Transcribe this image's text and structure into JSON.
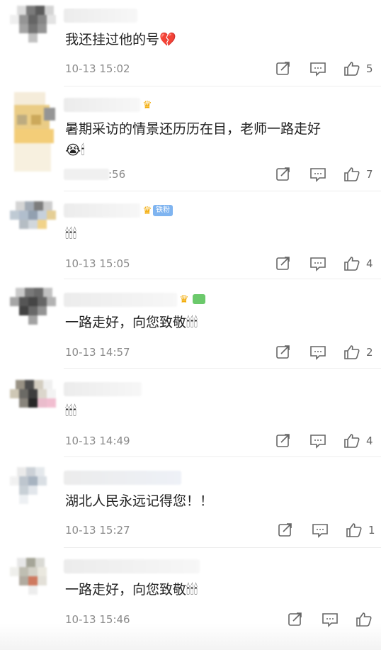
{
  "comments": [
    {
      "text": "我还挂过他的号",
      "emoji": "💔",
      "time": "10-13 15:02",
      "likes": "5"
    },
    {
      "text": "暑期采访的情景还历历在目，老师一路走好",
      "emoji": "😭🕯",
      "time": ":56",
      "likes": "7"
    },
    {
      "text": "",
      "emoji": "🕯🕯🕯",
      "time": "10-13 15:05",
      "likes": "4",
      "badge": "铁粉"
    },
    {
      "text": "一路走好，向您致敬",
      "emoji": "🕯🕯🕯",
      "time": "10-13 14:57",
      "likes": "2"
    },
    {
      "text": "",
      "emoji": "🕯🕯🕯",
      "time": "10-13 14:49",
      "likes": "4"
    },
    {
      "text": "湖北人民永远记得您！！",
      "emoji": "",
      "time": "10-13 15:27",
      "likes": "1"
    },
    {
      "text": "一路走好，向您致敬",
      "emoji": "🕯🕯🕯",
      "time": "10-13 15:46",
      "likes": ""
    }
  ],
  "icons": {
    "share": "share-icon",
    "reply": "comment-icon",
    "like": "like-icon"
  }
}
